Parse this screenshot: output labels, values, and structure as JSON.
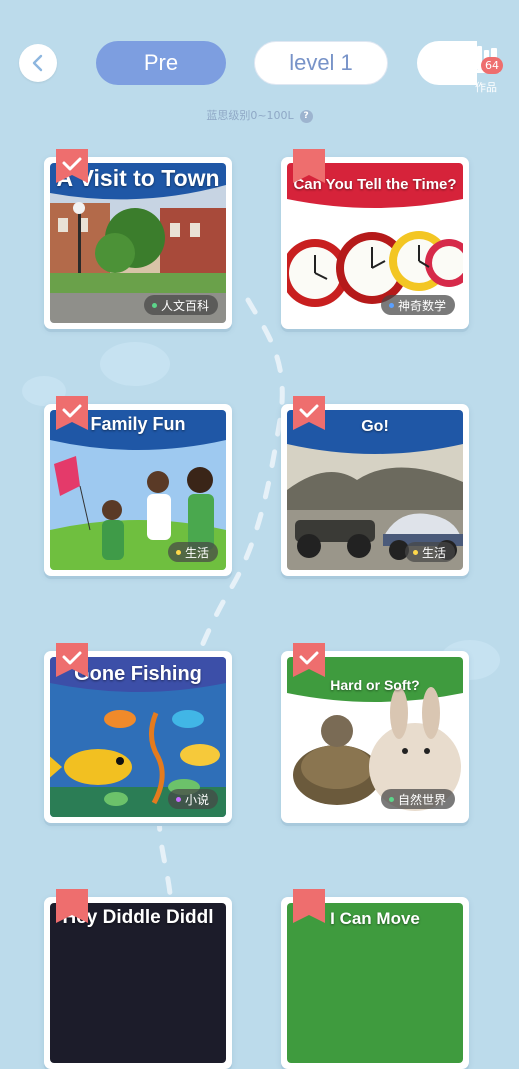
{
  "header": {
    "pill_pre": "Pre",
    "pill_level": "level 1",
    "works_label": "作品",
    "works_count": "64",
    "subtitle": "蓝思级别0~100L",
    "help_glyph": "?"
  },
  "colors": {
    "background": "#bcdbeb",
    "accent_blue": "#7d9ee0",
    "marker_red": "#ee6e6e"
  },
  "books": [
    {
      "title": "A Visit to Town",
      "tag": "人文百科",
      "tag_dot": "#5cd58a",
      "status": "completed"
    },
    {
      "title": "Can You Tell the Time?",
      "tag": "神奇数学",
      "tag_dot": "#5aa0ff",
      "status": "bookmark"
    },
    {
      "title": "Family Fun",
      "tag": "生活",
      "tag_dot": "#ffd84a",
      "status": "completed"
    },
    {
      "title": "Go!",
      "tag": "生活",
      "tag_dot": "#ffd84a",
      "status": "completed"
    },
    {
      "title": "Gone Fishing",
      "tag": "小说",
      "tag_dot": "#c66cff",
      "status": "completed"
    },
    {
      "title": "Hard or Soft?",
      "tag": "自然世界",
      "tag_dot": "#5cd58a",
      "status": "completed"
    },
    {
      "title": "Hey Diddle Diddl",
      "status": "bookmark"
    },
    {
      "title": "I Can Move",
      "status": "bookmark"
    }
  ]
}
